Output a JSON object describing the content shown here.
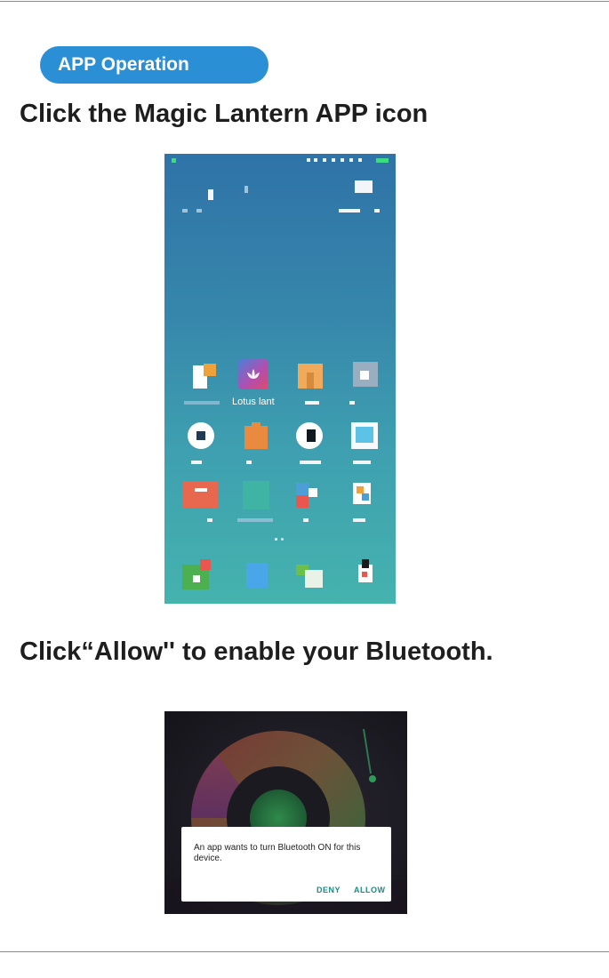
{
  "section_badge": "APP Operation",
  "step1": {
    "heading": "Click the Magic Lantern APP icon",
    "app_label": "Lotus lant"
  },
  "step2": {
    "heading": "Click“Allow'' to enable your Bluetooth.",
    "dialog_message": "An app wants to turn Bluetooth ON for this device.",
    "deny_label": "DENY",
    "allow_label": "ALLOW"
  },
  "colors": {
    "badge": "#2a8fd4",
    "dialog_button": "#1c8a86",
    "text": "#1e1e1e"
  }
}
